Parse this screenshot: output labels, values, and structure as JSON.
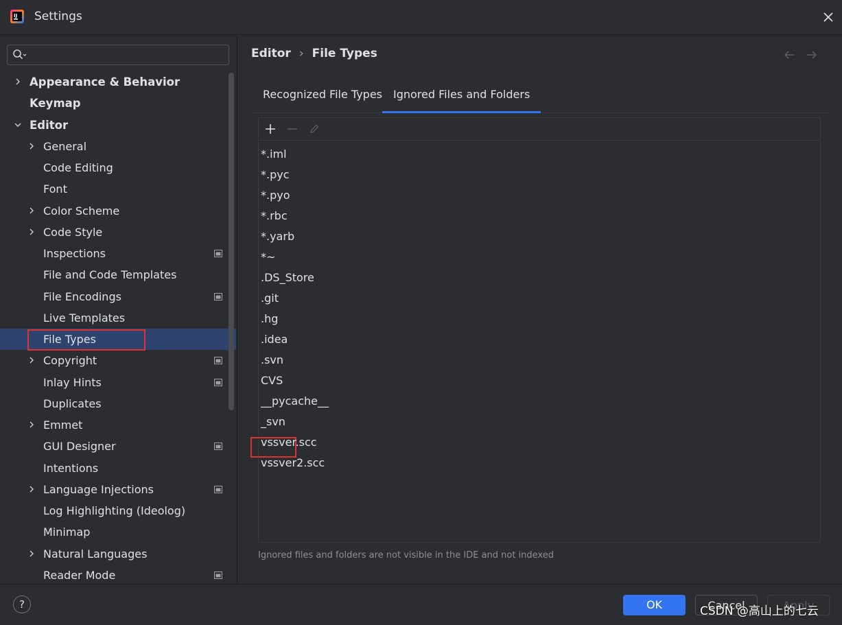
{
  "window": {
    "title": "Settings"
  },
  "sidebar": {
    "search": {
      "value": "",
      "placeholder": ""
    },
    "items": [
      {
        "label": "Appearance & Behavior",
        "level": 0,
        "chevron": "right"
      },
      {
        "label": "Keymap",
        "level": 0,
        "chevron": "none"
      },
      {
        "label": "Editor",
        "level": 0,
        "chevron": "down"
      },
      {
        "label": "General",
        "level": 1,
        "chevron": "right"
      },
      {
        "label": "Code Editing",
        "level": 1,
        "chevron": "none"
      },
      {
        "label": "Font",
        "level": 1,
        "chevron": "none"
      },
      {
        "label": "Color Scheme",
        "level": 1,
        "chevron": "right"
      },
      {
        "label": "Code Style",
        "level": 1,
        "chevron": "right"
      },
      {
        "label": "Inspections",
        "level": 1,
        "chevron": "none",
        "project_icon": true
      },
      {
        "label": "File and Code Templates",
        "level": 1,
        "chevron": "none"
      },
      {
        "label": "File Encodings",
        "level": 1,
        "chevron": "none",
        "project_icon": true
      },
      {
        "label": "Live Templates",
        "level": 1,
        "chevron": "none"
      },
      {
        "label": "File Types",
        "level": 1,
        "chevron": "none",
        "selected": true
      },
      {
        "label": "Copyright",
        "level": 1,
        "chevron": "right",
        "project_icon": true
      },
      {
        "label": "Inlay Hints",
        "level": 1,
        "chevron": "none",
        "project_icon": true
      },
      {
        "label": "Duplicates",
        "level": 1,
        "chevron": "none"
      },
      {
        "label": "Emmet",
        "level": 1,
        "chevron": "right"
      },
      {
        "label": "GUI Designer",
        "level": 1,
        "chevron": "none",
        "project_icon": true
      },
      {
        "label": "Intentions",
        "level": 1,
        "chevron": "none"
      },
      {
        "label": "Language Injections",
        "level": 1,
        "chevron": "right",
        "project_icon": true
      },
      {
        "label": "Log Highlighting (Ideolog)",
        "level": 1,
        "chevron": "none"
      },
      {
        "label": "Minimap",
        "level": 1,
        "chevron": "none"
      },
      {
        "label": "Natural Languages",
        "level": 1,
        "chevron": "right"
      },
      {
        "label": "Reader Mode",
        "level": 1,
        "chevron": "none",
        "project_icon": true
      }
    ]
  },
  "breadcrumb": {
    "parent": "Editor",
    "separator": "›",
    "current": "File Types"
  },
  "tabs": [
    {
      "label": "Recognized File Types",
      "active": false
    },
    {
      "label": "Ignored Files and Folders",
      "active": true
    }
  ],
  "toolbar": {
    "add_icon": "plus-icon",
    "remove_icon": "minus-icon",
    "edit_icon": "pencil-icon"
  },
  "ignored_list": [
    "*.iml",
    "*.pyc",
    "*.pyo",
    "*.rbc",
    "*.yarb",
    "*~",
    ".DS_Store",
    ".git",
    ".hg",
    ".idea",
    ".svn",
    "CVS",
    "__pycache__",
    "_svn",
    "vssver.scc",
    "vssver2.scc"
  ],
  "hint": "Ignored files and folders are not visible in the IDE and not indexed",
  "footer": {
    "help_label": "?",
    "ok_label": "OK",
    "cancel_label": "Cancel",
    "apply_label": "Apply"
  },
  "watermark": "CSDN @高山上的七云",
  "colors": {
    "background": "#2b2d30",
    "selection": "#2e436e",
    "accent": "#3574f0",
    "annotation": "#e03232"
  }
}
